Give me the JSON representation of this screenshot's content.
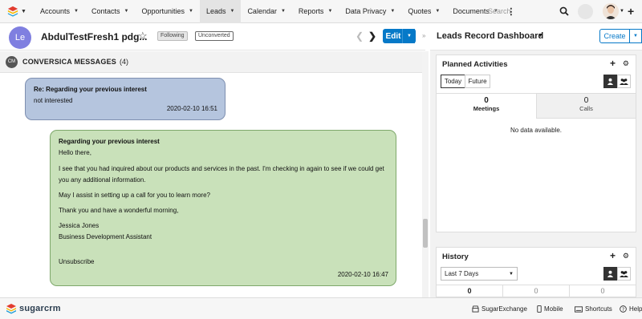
{
  "nav": {
    "tabs": [
      {
        "label": "Accounts",
        "active": false
      },
      {
        "label": "Contacts",
        "active": false
      },
      {
        "label": "Opportunities",
        "active": false
      },
      {
        "label": "Leads",
        "active": true
      },
      {
        "label": "Calendar",
        "active": false
      },
      {
        "label": "Reports",
        "active": false
      },
      {
        "label": "Data Privacy",
        "active": false
      },
      {
        "label": "Quotes",
        "active": false
      },
      {
        "label": "Documents",
        "active": false
      }
    ],
    "search_placeholder": "Search"
  },
  "record": {
    "avatar_initials": "Le",
    "title": "AbdulTestFresh1 pdg...",
    "following_label": "Following",
    "status_label": "Unconverted",
    "edit_label": "Edit"
  },
  "subpanel": {
    "icon_label": "CM",
    "title": "CONVERSICA MESSAGES",
    "count": "(4)"
  },
  "messages": {
    "incoming": {
      "subject": "Re: Regarding your previous interest",
      "body": "not interested",
      "timestamp": "2020-02-10 16:51"
    },
    "outgoing": {
      "subject": "Regarding your previous interest",
      "greeting": "Hello there,",
      "para1": "I see that you had inquired about our products and services in the past. I'm checking in again to see if we could get you any additional information.",
      "para2": "May I assist in setting up a call for you to learn more?",
      "para3": "Thank you and have a wonderful morning,",
      "sig_name": "Jessica Jones",
      "sig_title": "Business Development Assistant",
      "unsubscribe": "Unsubscribe",
      "timestamp": "2020-02-10 16:47"
    }
  },
  "dashboard": {
    "title": "Leads Record Dashboard",
    "create_label": "Create",
    "planned": {
      "title": "Planned Activities",
      "today_label": "Today",
      "future_label": "Future",
      "meetings_count": "0",
      "meetings_label": "Meetings",
      "calls_count": "0",
      "calls_label": "Calls",
      "empty_text": "No data available."
    },
    "history": {
      "title": "History",
      "range_label": "Last 7 Days",
      "counts": [
        "0",
        "0",
        "0"
      ]
    }
  },
  "footer": {
    "brand": "sugarcrm",
    "links": [
      "SugarExchange",
      "Mobile",
      "Shortcuts",
      "Help"
    ]
  },
  "colors": {
    "primary": "#0679c8",
    "incoming_bubble": "#b5c5de",
    "outgoing_bubble": "#c9e1ba",
    "avatar": "#7f7fe0"
  }
}
